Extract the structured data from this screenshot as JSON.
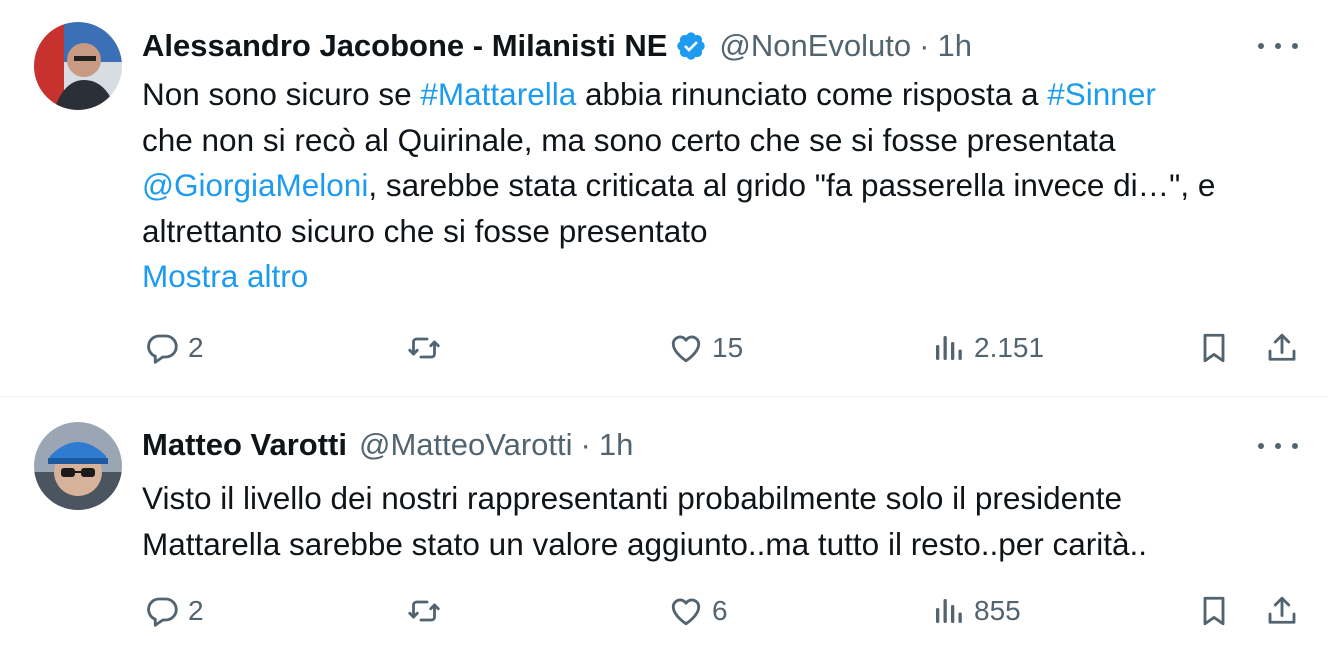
{
  "tweets": [
    {
      "name": "Alessandro Jacobone - Milanisti NE",
      "verified": true,
      "handle": "@NonEvoluto",
      "dot": "·",
      "time": "1h",
      "text_lines": [
        [
          {
            "t": "Non sono sicuro se "
          },
          {
            "t": "#Mattarella",
            "link": true
          },
          {
            "t": " abbia rinunciato come risposta a "
          },
          {
            "t": "#Sinner",
            "link": true
          }
        ],
        [
          {
            "t": "che non si recò al Quirinale, ma sono certo che se si fosse presentata"
          }
        ],
        [
          {
            "t": "@GiorgiaMeloni",
            "link": true
          },
          {
            "t": ", sarebbe stata criticata al grido \"fa passerella invece di…\", e"
          }
        ],
        [
          {
            "t": "altrettanto sicuro che si fosse presentato"
          }
        ]
      ],
      "show_more": "Mostra altro",
      "stats": {
        "replies": "2",
        "reposts": "",
        "likes": "15",
        "views": "2.151"
      }
    },
    {
      "name": "Matteo Varotti",
      "verified": false,
      "handle": "@MatteoVarotti",
      "dot": "·",
      "time": "1h",
      "text_lines": [
        [
          {
            "t": "Visto il livello dei nostri rappresentanti probabilmente solo il presidente"
          }
        ],
        [
          {
            "t": "Mattarella sarebbe stato un valore aggiunto..ma tutto il resto..per carità.."
          }
        ]
      ],
      "show_more": "",
      "stats": {
        "replies": "2",
        "reposts": "",
        "likes": "6",
        "views": "855"
      }
    }
  ],
  "colors": {
    "link": "#1d9bf0",
    "muted": "#536471",
    "text": "#0f1419",
    "verified": "#1d9bf0"
  },
  "icons": [
    "reply-icon",
    "repost-icon",
    "like-icon",
    "views-icon",
    "bookmark-icon",
    "share-icon",
    "more-icon",
    "verified-badge-icon"
  ]
}
